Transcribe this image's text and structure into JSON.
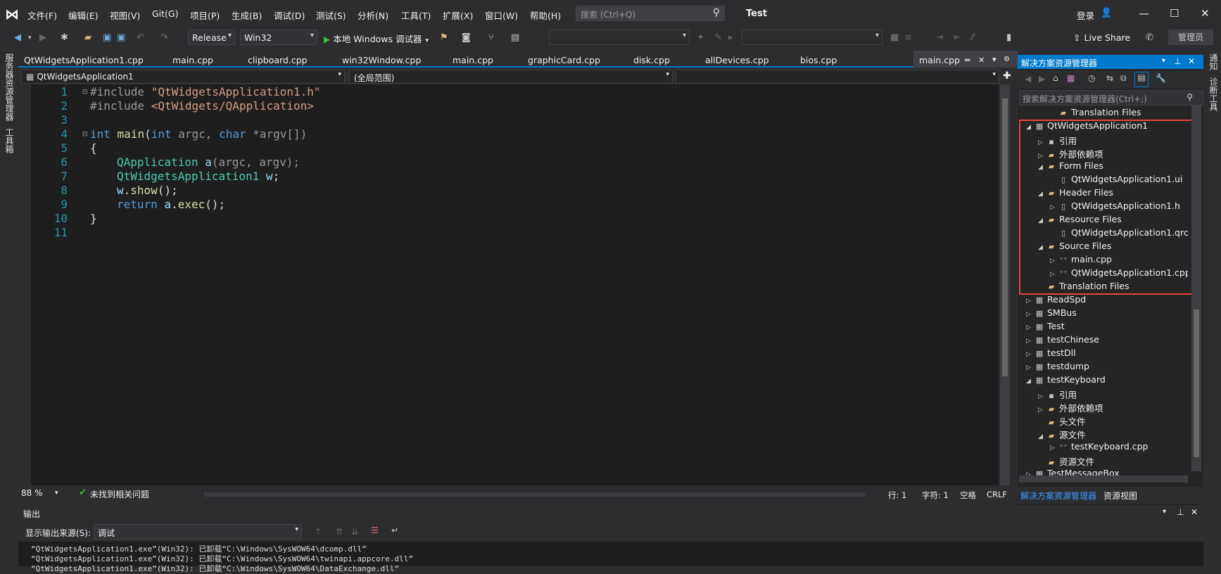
{
  "menu": {
    "items": [
      "文件(F)",
      "编辑(E)",
      "视图(V)",
      "Git(G)",
      "项目(P)",
      "生成(B)",
      "调试(D)",
      "测试(S)",
      "分析(N)",
      "工具(T)",
      "扩展(X)",
      "窗口(W)",
      "帮助(H)"
    ],
    "search_placeholder": "搜索 (Ctrl+Q)",
    "project_name": "Test",
    "login": "登录"
  },
  "toolbar": {
    "config": "Release",
    "platform": "Win32",
    "run_label": "本地 Windows 调试器",
    "live_share": "Live Share",
    "admin": "管理员"
  },
  "left_strip": [
    "服务器资源管理器",
    "工具箱"
  ],
  "right_strip": [
    "通知",
    "诊断工具"
  ],
  "tabs": [
    "QtWidgetsApplication1.cpp",
    "main.cpp",
    "clipboard.cpp",
    "win32Window.cpp",
    "main.cpp",
    "graphicCard.cpp",
    "disk.cpp",
    "allDevices.cpp",
    "bios.cpp"
  ],
  "active_tab": "main.cpp",
  "navbar": {
    "project": "QtWidgetsApplication1",
    "scope": "(全局范围)"
  },
  "editor": {
    "line_numbers": [
      "1",
      "2",
      "3",
      "4",
      "5",
      "6",
      "7",
      "8",
      "9",
      "10",
      "11"
    ],
    "lines": {
      "l1_pp": "#include ",
      "l1_str": "\"QtWidgetsApplication1.h\"",
      "l2_pp": "#include ",
      "l2_str": "<QtWidgets/QApplication>",
      "l4_kw": "int",
      "l4_fn": " main",
      "l4_rest_a": "(",
      "l4_kw2": "int",
      "l4_rest_b": " argc, ",
      "l4_kw3": "char",
      "l4_rest_c": " *argv[])",
      "l5": "{",
      "l6_typ": "QApplication",
      "l6_var": " a",
      "l6_rest": "(argc, argv);",
      "l7_typ": "QtWidgetsApplication1",
      "l7_var": " w",
      "l7_rest": ";",
      "l8_var": "w",
      "l8_rest": ".",
      "l8_fn": "show",
      "l8_rest2": "();",
      "l9_kw": "return",
      "l9_var": " a",
      "l9_rest": ".",
      "l9_fn": "exec",
      "l9_rest2": "();",
      "l10": "}"
    }
  },
  "status": {
    "zoom": "88 %",
    "issues": "未找到相关问题",
    "line": "行: 1",
    "char": "字符: 1",
    "space": "空格",
    "eol": "CRLF"
  },
  "output": {
    "title": "输出",
    "source_label": "显示输出来源(S):",
    "source_value": "调试",
    "lines": [
      "“QtWidgetsApplication1.exe”(Win32): 已卸载“C:\\Windows\\SysWOW64\\dcomp.dll”",
      "“QtWidgetsApplication1.exe”(Win32): 已卸载“C:\\Windows\\SysWOW64\\twinapi.appcore.dll”",
      "“QtWidgetsApplication1.exe”(Win32): 已卸载“C:\\Windows\\SysWOW64\\DataExchange.dll”"
    ]
  },
  "solution_explorer": {
    "title": "解决方案资源管理器",
    "search_placeholder": "搜索解决方案资源管理器(Ctrl+;)",
    "tab_active": "解决方案资源管理器",
    "tab_other": "资源视图",
    "tree": [
      {
        "label": "Translation Files",
        "indent": 2,
        "arrow": "",
        "icon": "folder"
      },
      {
        "label": "QtWidgetsApplication1",
        "indent": 0,
        "arrow": "open",
        "icon": "proj"
      },
      {
        "label": "引用",
        "indent": 1,
        "arrow": "closed",
        "icon": "ref"
      },
      {
        "label": "外部依赖项",
        "indent": 1,
        "arrow": "closed",
        "icon": "folder"
      },
      {
        "label": "Form Files",
        "indent": 1,
        "arrow": "open",
        "icon": "folder"
      },
      {
        "label": "QtWidgetsApplication1.ui",
        "indent": 2,
        "arrow": "",
        "icon": "file"
      },
      {
        "label": "Header Files",
        "indent": 1,
        "arrow": "open",
        "icon": "folder"
      },
      {
        "label": "QtWidgetsApplication1.h",
        "indent": 2,
        "arrow": "closed",
        "icon": "file"
      },
      {
        "label": "Resource Files",
        "indent": 1,
        "arrow": "open",
        "icon": "folder"
      },
      {
        "label": "QtWidgetsApplication1.qrc",
        "indent": 2,
        "arrow": "",
        "icon": "file"
      },
      {
        "label": "Source Files",
        "indent": 1,
        "arrow": "open",
        "icon": "folder"
      },
      {
        "label": "main.cpp",
        "indent": 2,
        "arrow": "closed",
        "icon": "cpp"
      },
      {
        "label": "QtWidgetsApplication1.cpp",
        "indent": 2,
        "arrow": "closed",
        "icon": "cpp"
      },
      {
        "label": "Translation Files",
        "indent": 1,
        "arrow": "",
        "icon": "folder"
      },
      {
        "label": "ReadSpd",
        "indent": 0,
        "arrow": "closed",
        "icon": "proj"
      },
      {
        "label": "SMBus",
        "indent": 0,
        "arrow": "closed",
        "icon": "proj"
      },
      {
        "label": "Test",
        "indent": 0,
        "arrow": "closed",
        "icon": "proj"
      },
      {
        "label": "testChinese",
        "indent": 0,
        "arrow": "closed",
        "icon": "proj"
      },
      {
        "label": "testDll",
        "indent": 0,
        "arrow": "closed",
        "icon": "proj"
      },
      {
        "label": "testdump",
        "indent": 0,
        "arrow": "closed",
        "icon": "proj"
      },
      {
        "label": "testKeyboard",
        "indent": 0,
        "arrow": "open",
        "icon": "proj"
      },
      {
        "label": "引用",
        "indent": 1,
        "arrow": "closed",
        "icon": "ref"
      },
      {
        "label": "外部依赖项",
        "indent": 1,
        "arrow": "closed",
        "icon": "folder"
      },
      {
        "label": "头文件",
        "indent": 1,
        "arrow": "",
        "icon": "folder"
      },
      {
        "label": "源文件",
        "indent": 1,
        "arrow": "open",
        "icon": "folder"
      },
      {
        "label": "testKeyboard.cpp",
        "indent": 2,
        "arrow": "closed",
        "icon": "cpp"
      },
      {
        "label": "资源文件",
        "indent": 1,
        "arrow": "",
        "icon": "folder"
      },
      {
        "label": "TestMessageBox",
        "indent": 0,
        "arrow": "closed",
        "icon": "proj"
      }
    ]
  },
  "colors": {
    "accent": "#007acc",
    "highlight_box": "#e8443a",
    "background": "#1e1e1e"
  }
}
